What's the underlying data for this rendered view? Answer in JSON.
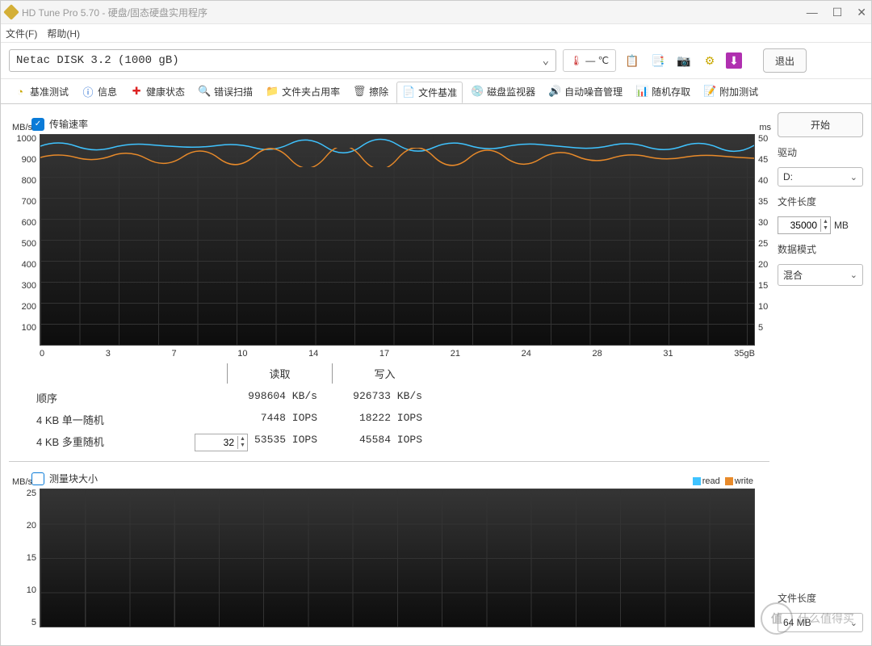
{
  "window": {
    "title": "HD Tune Pro 5.70 - 硬盘/固态硬盘实用程序"
  },
  "menu": {
    "file": "文件(F)",
    "help": "帮助(H)"
  },
  "drive": {
    "selected": "Netac  DISK 3.2 (1000 gB)"
  },
  "temperature": {
    "value": "— ℃"
  },
  "exit_label": "退出",
  "tabs": [
    {
      "label": "基准测试"
    },
    {
      "label": "信息"
    },
    {
      "label": "健康状态"
    },
    {
      "label": "错误扫描"
    },
    {
      "label": "文件夹占用率"
    },
    {
      "label": "擦除"
    },
    {
      "label": "文件基准"
    },
    {
      "label": "磁盘监视器"
    },
    {
      "label": "自动噪音管理"
    },
    {
      "label": "随机存取"
    },
    {
      "label": "附加测试"
    }
  ],
  "active_tab": 6,
  "checkbox_transfer": {
    "label": "传输速率",
    "checked": true
  },
  "chart_data": {
    "type": "line",
    "title": "",
    "y_unit_left": "MB/s",
    "y_unit_right": "ms",
    "x_unit": "gB",
    "x_ticks": [
      "0",
      "3",
      "7",
      "10",
      "14",
      "17",
      "21",
      "24",
      "28",
      "31",
      "35gB"
    ],
    "y_left_ticks": [
      "1000",
      "900",
      "800",
      "700",
      "600",
      "500",
      "400",
      "300",
      "200",
      "100",
      ""
    ],
    "y_right_ticks": [
      "50",
      "45",
      "40",
      "35",
      "30",
      "25",
      "20",
      "15",
      "10",
      "5",
      ""
    ],
    "ylim_left": [
      0,
      1000
    ],
    "ylim_right": [
      0,
      50
    ],
    "series": [
      {
        "name": "read",
        "color": "#3fc3ff",
        "approx_value": 985
      },
      {
        "name": "write",
        "color": "#e88a2a",
        "approx_value": 920
      }
    ]
  },
  "results": {
    "headers": {
      "read": "读取",
      "write": "写入"
    },
    "rows": [
      {
        "label": "顺序",
        "read": "998604  KB/s",
        "write": "926733  KB/s"
      },
      {
        "label": "4 KB 单一随机",
        "read": "7448  IOPS",
        "write": "18222  IOPS"
      },
      {
        "label": "4 KB 多重随机",
        "read": "53535  IOPS",
        "write": "45584  IOPS"
      }
    ],
    "multi_depth": "32"
  },
  "checkbox_blocksize": {
    "label": "测量块大小",
    "checked": false
  },
  "chart2": {
    "type": "line",
    "y_unit": "MB/s",
    "y_ticks": [
      "25",
      "20",
      "15",
      "10",
      "5"
    ],
    "legend": [
      {
        "name": "read",
        "color": "#3fc3ff"
      },
      {
        "name": "write",
        "color": "#e88a2a"
      }
    ],
    "series": []
  },
  "side": {
    "start": "开始",
    "drive_label": "驱动",
    "drive_value": "D:",
    "filelen_label": "文件长度",
    "filelen_value": "35000",
    "filelen_unit": "MB",
    "mode_label": "数据模式",
    "mode_value": "混合",
    "filelen2_label": "文件长度",
    "filelen2_value": "64 MB"
  },
  "watermark": "什么值得买",
  "watermark_badge": "值"
}
